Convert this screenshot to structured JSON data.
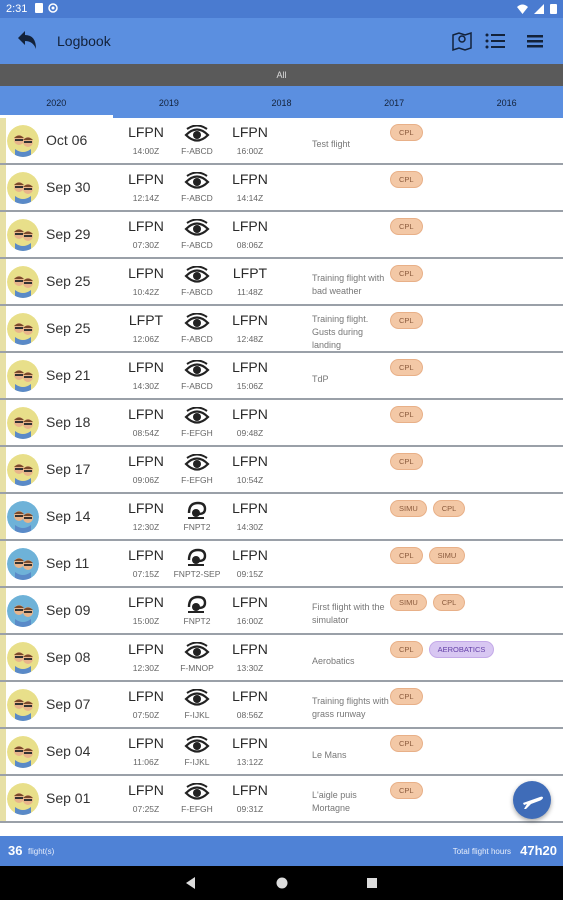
{
  "status": {
    "time": "2:31"
  },
  "header": {
    "title": "Logbook"
  },
  "filter": {
    "label": "All"
  },
  "years": [
    "2020",
    "2019",
    "2018",
    "2017",
    "2016"
  ],
  "active_year": "2020",
  "flights": [
    {
      "date": "Oct 06",
      "from": "LFPN",
      "dep": "14:00Z",
      "reg": "F-ABCD",
      "to": "LFPN",
      "arr": "16:00Z",
      "remark": "Test flight",
      "tags": [
        "CPL"
      ],
      "avatar": "yellow",
      "icon": "eye"
    },
    {
      "date": "Sep 30",
      "from": "LFPN",
      "dep": "12:14Z",
      "reg": "F-ABCD",
      "to": "LFPN",
      "arr": "14:14Z",
      "remark": "",
      "tags": [
        "CPL"
      ],
      "avatar": "yellow",
      "icon": "eye"
    },
    {
      "date": "Sep 29",
      "from": "LFPN",
      "dep": "07:30Z",
      "reg": "F-ABCD",
      "to": "LFPN",
      "arr": "08:06Z",
      "remark": "",
      "tags": [
        "CPL"
      ],
      "avatar": "yellow",
      "icon": "eye"
    },
    {
      "date": "Sep 25",
      "from": "LFPN",
      "dep": "10:42Z",
      "reg": "F-ABCD",
      "to": "LFPT",
      "arr": "11:48Z",
      "remark": "Training flight with bad weather",
      "tags": [
        "CPL"
      ],
      "avatar": "yellow",
      "icon": "eye"
    },
    {
      "date": "Sep 25",
      "from": "LFPT",
      "dep": "12:06Z",
      "reg": "F-ABCD",
      "to": "LFPN",
      "arr": "12:48Z",
      "remark": "Training flight. Gusts during landing",
      "tags": [
        "CPL"
      ],
      "avatar": "yellow",
      "icon": "eye"
    },
    {
      "date": "Sep 21",
      "from": "LFPN",
      "dep": "14:30Z",
      "reg": "F-ABCD",
      "to": "LFPN",
      "arr": "15:06Z",
      "remark": "TdP",
      "tags": [
        "CPL"
      ],
      "avatar": "yellow",
      "icon": "eye"
    },
    {
      "date": "Sep 18",
      "from": "LFPN",
      "dep": "08:54Z",
      "reg": "F-EFGH",
      "to": "LFPN",
      "arr": "09:48Z",
      "remark": "",
      "tags": [
        "CPL"
      ],
      "avatar": "yellow",
      "icon": "eye"
    },
    {
      "date": "Sep 17",
      "from": "LFPN",
      "dep": "09:06Z",
      "reg": "F-EFGH",
      "to": "LFPN",
      "arr": "10:54Z",
      "remark": "",
      "tags": [
        "CPL"
      ],
      "avatar": "yellow",
      "icon": "eye"
    },
    {
      "date": "Sep 14",
      "from": "LFPN",
      "dep": "12:30Z",
      "reg": "FNPT2",
      "to": "LFPN",
      "arr": "14:30Z",
      "remark": "",
      "tags": [
        "SIMU",
        "CPL"
      ],
      "avatar": "blue",
      "icon": "sim"
    },
    {
      "date": "Sep 11",
      "from": "LFPN",
      "dep": "07:15Z",
      "reg": "FNPT2-SEP",
      "to": "LFPN",
      "arr": "09:15Z",
      "remark": "",
      "tags": [
        "CPL",
        "SIMU"
      ],
      "avatar": "blue",
      "icon": "sim"
    },
    {
      "date": "Sep 09",
      "from": "LFPN",
      "dep": "15:00Z",
      "reg": "FNPT2",
      "to": "LFPN",
      "arr": "16:00Z",
      "remark": "First flight with the simulator",
      "tags": [
        "SIMU",
        "CPL"
      ],
      "avatar": "blue",
      "icon": "sim"
    },
    {
      "date": "Sep 08",
      "from": "LFPN",
      "dep": "12:30Z",
      "reg": "F-MNOP",
      "to": "LFPN",
      "arr": "13:30Z",
      "remark": "Aerobatics",
      "tags": [
        "CPL",
        "AEROBATICS"
      ],
      "avatar": "yellow",
      "icon": "eye"
    },
    {
      "date": "Sep 07",
      "from": "LFPN",
      "dep": "07:50Z",
      "reg": "F-IJKL",
      "to": "LFPN",
      "arr": "08:56Z",
      "remark": "Training flights with grass runway",
      "tags": [
        "CPL"
      ],
      "avatar": "yellow",
      "icon": "eye"
    },
    {
      "date": "Sep 04",
      "from": "LFPN",
      "dep": "11:06Z",
      "reg": "F-IJKL",
      "to": "LFPN",
      "arr": "13:12Z",
      "remark": "Le Mans",
      "tags": [
        "CPL"
      ],
      "avatar": "yellow",
      "icon": "eye"
    },
    {
      "date": "Sep 01",
      "from": "LFPN",
      "dep": "07:25Z",
      "reg": "F-EFGH",
      "to": "LFPN",
      "arr": "09:31Z",
      "remark": "L'aigle puis Mortagne",
      "tags": [
        "CPL"
      ],
      "avatar": "yellow",
      "icon": "eye"
    }
  ],
  "footer": {
    "count": "36",
    "count_label": "flight(s)",
    "total_label": "Total flight hours",
    "total_value": "47h20"
  },
  "colors": {
    "appbar": "#5b8fe0",
    "footer": "#4f82d6",
    "tag_cpl": "#f3c8a6",
    "tag_aerobatics": "#d8c7f2"
  }
}
